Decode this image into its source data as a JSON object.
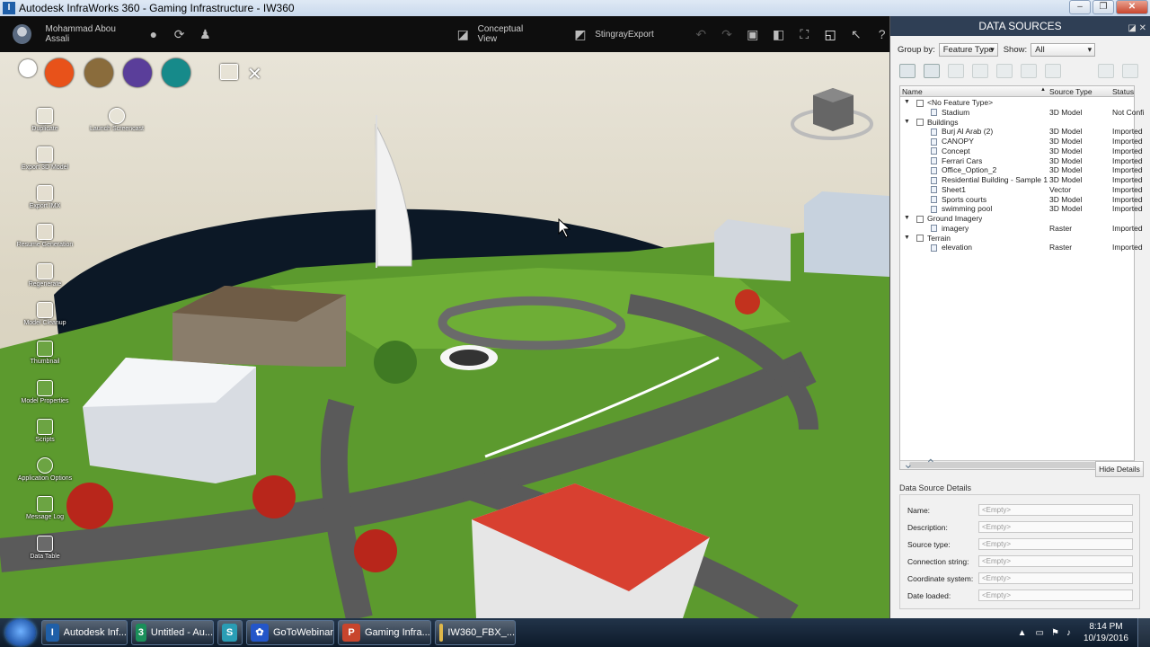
{
  "window": {
    "title": "Autodesk InfraWorks 360 - Gaming Infrastructure - IW360",
    "app_icon": "I",
    "min_label": "–",
    "max_label": "❐",
    "close_label": "✕"
  },
  "toolbar": {
    "user_name": "Mohammad Abou Assali",
    "conceptual_view": "Conceptual View",
    "stingray_export": "StingrayExport"
  },
  "left_tools": [
    {
      "label": "Duplicate"
    },
    {
      "label": "Launch Screencast"
    },
    {
      "label": "Export 3D Model"
    },
    {
      "label": "Export IMX"
    },
    {
      "label": "Resume Generation"
    },
    {
      "label": "Regenerate"
    },
    {
      "label": "Model Cleanup"
    },
    {
      "label": "Thumbnail"
    },
    {
      "label": "Model Properties"
    },
    {
      "label": "Scripts"
    },
    {
      "label": "Application Options"
    },
    {
      "label": "Message Log"
    },
    {
      "label": "Data Table"
    }
  ],
  "mode_colors": {
    "home": "#ffffff",
    "build": "#e8521a",
    "analyze": "#8a6c3c",
    "design": "#5a3e9a",
    "present": "#168a8a"
  },
  "panel": {
    "title": "DATA SOURCES",
    "group_by_label": "Group by:",
    "group_by_value": "Feature Type",
    "show_label": "Show:",
    "show_value": "All",
    "columns": {
      "name": "Name",
      "source_type": "Source Type",
      "status": "Status"
    },
    "rows": [
      {
        "name": "<No Feature Type>",
        "type": "",
        "status": "",
        "level": 0,
        "group": true
      },
      {
        "name": "Stadium",
        "type": "3D Model",
        "status": "Not Confi",
        "level": 1,
        "group": false
      },
      {
        "name": "Buildings",
        "type": "",
        "status": "",
        "level": 0,
        "group": true
      },
      {
        "name": "Burj Al Arab (2)",
        "type": "3D Model",
        "status": "Imported",
        "level": 1,
        "group": false
      },
      {
        "name": "CANOPY",
        "type": "3D Model",
        "status": "Imported",
        "level": 1,
        "group": false
      },
      {
        "name": "Concept",
        "type": "3D Model",
        "status": "Imported",
        "level": 1,
        "group": false
      },
      {
        "name": "Ferrari Cars",
        "type": "3D Model",
        "status": "Imported",
        "level": 1,
        "group": false
      },
      {
        "name": "Office_Option_2",
        "type": "3D Model",
        "status": "Imported",
        "level": 1,
        "group": false
      },
      {
        "name": "Residential Building - Sample 1",
        "type": "3D Model",
        "status": "Imported",
        "level": 1,
        "group": false
      },
      {
        "name": "Sheet1",
        "type": "Vector",
        "status": "Imported",
        "level": 1,
        "group": false
      },
      {
        "name": "Sports courts",
        "type": "3D Model",
        "status": "Imported",
        "level": 1,
        "group": false
      },
      {
        "name": "swimming pool",
        "type": "3D Model",
        "status": "Imported",
        "level": 1,
        "group": false
      },
      {
        "name": "Ground Imagery",
        "type": "",
        "status": "",
        "level": 0,
        "group": true
      },
      {
        "name": "imagery",
        "type": "Raster",
        "status": "Imported",
        "level": 1,
        "group": false
      },
      {
        "name": "Terrain",
        "type": "",
        "status": "",
        "level": 0,
        "group": true
      },
      {
        "name": "elevation",
        "type": "Raster",
        "status": "Imported",
        "level": 1,
        "group": false
      }
    ],
    "hide_details": "Hide Details",
    "details_title": "Data Source Details",
    "details": [
      {
        "label": "Name:",
        "value": "<Empty>"
      },
      {
        "label": "Description:",
        "value": "<Empty>"
      },
      {
        "label": "Source type:",
        "value": "<Empty>"
      },
      {
        "label": "Connection string:",
        "value": "<Empty>"
      },
      {
        "label": "Coordinate system:",
        "value": "<Empty>"
      },
      {
        "label": "Date loaded:",
        "value": "<Empty>"
      }
    ]
  },
  "taskbar": {
    "items": [
      {
        "label": "Autodesk Inf...",
        "color": "#1f5fa8",
        "glyph": "I"
      },
      {
        "label": "Untitled - Au...",
        "color": "#1a8f5a",
        "glyph": "3"
      },
      {
        "label": "",
        "color": "#2a9db5",
        "glyph": "S"
      },
      {
        "label": "GoToWebinar",
        "color": "#2456c9",
        "glyph": "✿"
      },
      {
        "label": "Gaming Infra...",
        "color": "#c8452d",
        "glyph": "P"
      },
      {
        "label": "IW360_FBX_...",
        "color": "#e0b84a",
        "glyph": ""
      }
    ],
    "time": "8:14 PM",
    "date": "10/19/2016"
  }
}
